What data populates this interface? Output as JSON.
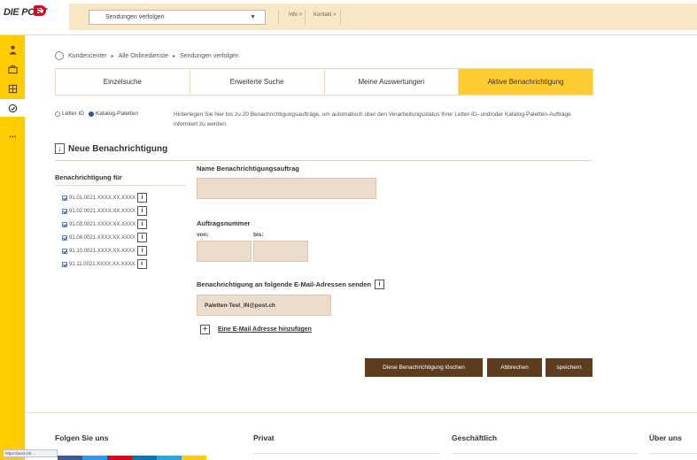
{
  "header": {
    "logo_text": "DIE POST",
    "logo_sub": "",
    "service_select": "Sendungen verfolgen",
    "nav_links": [
      "Info >",
      "Kontakt >"
    ]
  },
  "breadcrumb": [
    "Kundencenter",
    "Alle Onlinedienste",
    "Sendungen verfolgen"
  ],
  "tabs": [
    {
      "label": "Einzelsuche"
    },
    {
      "label": "Erweiterte Suche"
    },
    {
      "label": "Meine Auswertungen"
    },
    {
      "label": "Aktive Benachrichtigung"
    }
  ],
  "options": {
    "letter_id": "Letter ID",
    "katalog": "Katalog-Paletten"
  },
  "info_text": "Hinterlegen Sie hier bis zu 20 Benachrichtigungsaufträge, um automatisch über den Verarbeitungsstatus Ihrer Letter-ID- und/oder Katalog-Paletten-Aufträge informiert zu werden.",
  "section_title": "Neue Benachrichtigung",
  "left": {
    "heading": "Benachrichtigung für",
    "items": [
      "91.01.0021.XXXX.XX.XXXX",
      "91.02.0021.XXXX.XX.XXXX",
      "91.03.0021.XXXX.XX.XXXX",
      "91.04.0021.XXXX.XX.XXXX",
      "91.10.0021.XXXX.XX.XXXX",
      "91.11.0021.XXXX.XX.XXXX"
    ]
  },
  "form": {
    "name_label": "Name Benachrichtigungsauftrag",
    "name_value": "",
    "auftrag_label": "Auftragsnummer",
    "von_label": "von:",
    "bis_label": "bis:",
    "email_label": "Benachrichtigung an folgende E-Mail-Adressen senden",
    "email_value": "Paletten-Test_IN@post.ch",
    "add_email": "Eine E-Mail Adresse hinzufügen"
  },
  "buttons": {
    "delete": "Diese Benachrichtigung löschen",
    "cancel": "Abbrechen",
    "save": "speichern"
  },
  "footer": {
    "cols": [
      "Folgen Sie uns",
      "Privat",
      "Geschäftlich",
      "Über uns"
    ],
    "status_url": "https://post.ch/..."
  },
  "colors": {
    "brand_yellow": "#ffcc00",
    "button_brown": "#5c3d20",
    "field_bg": "#ecdccb"
  }
}
